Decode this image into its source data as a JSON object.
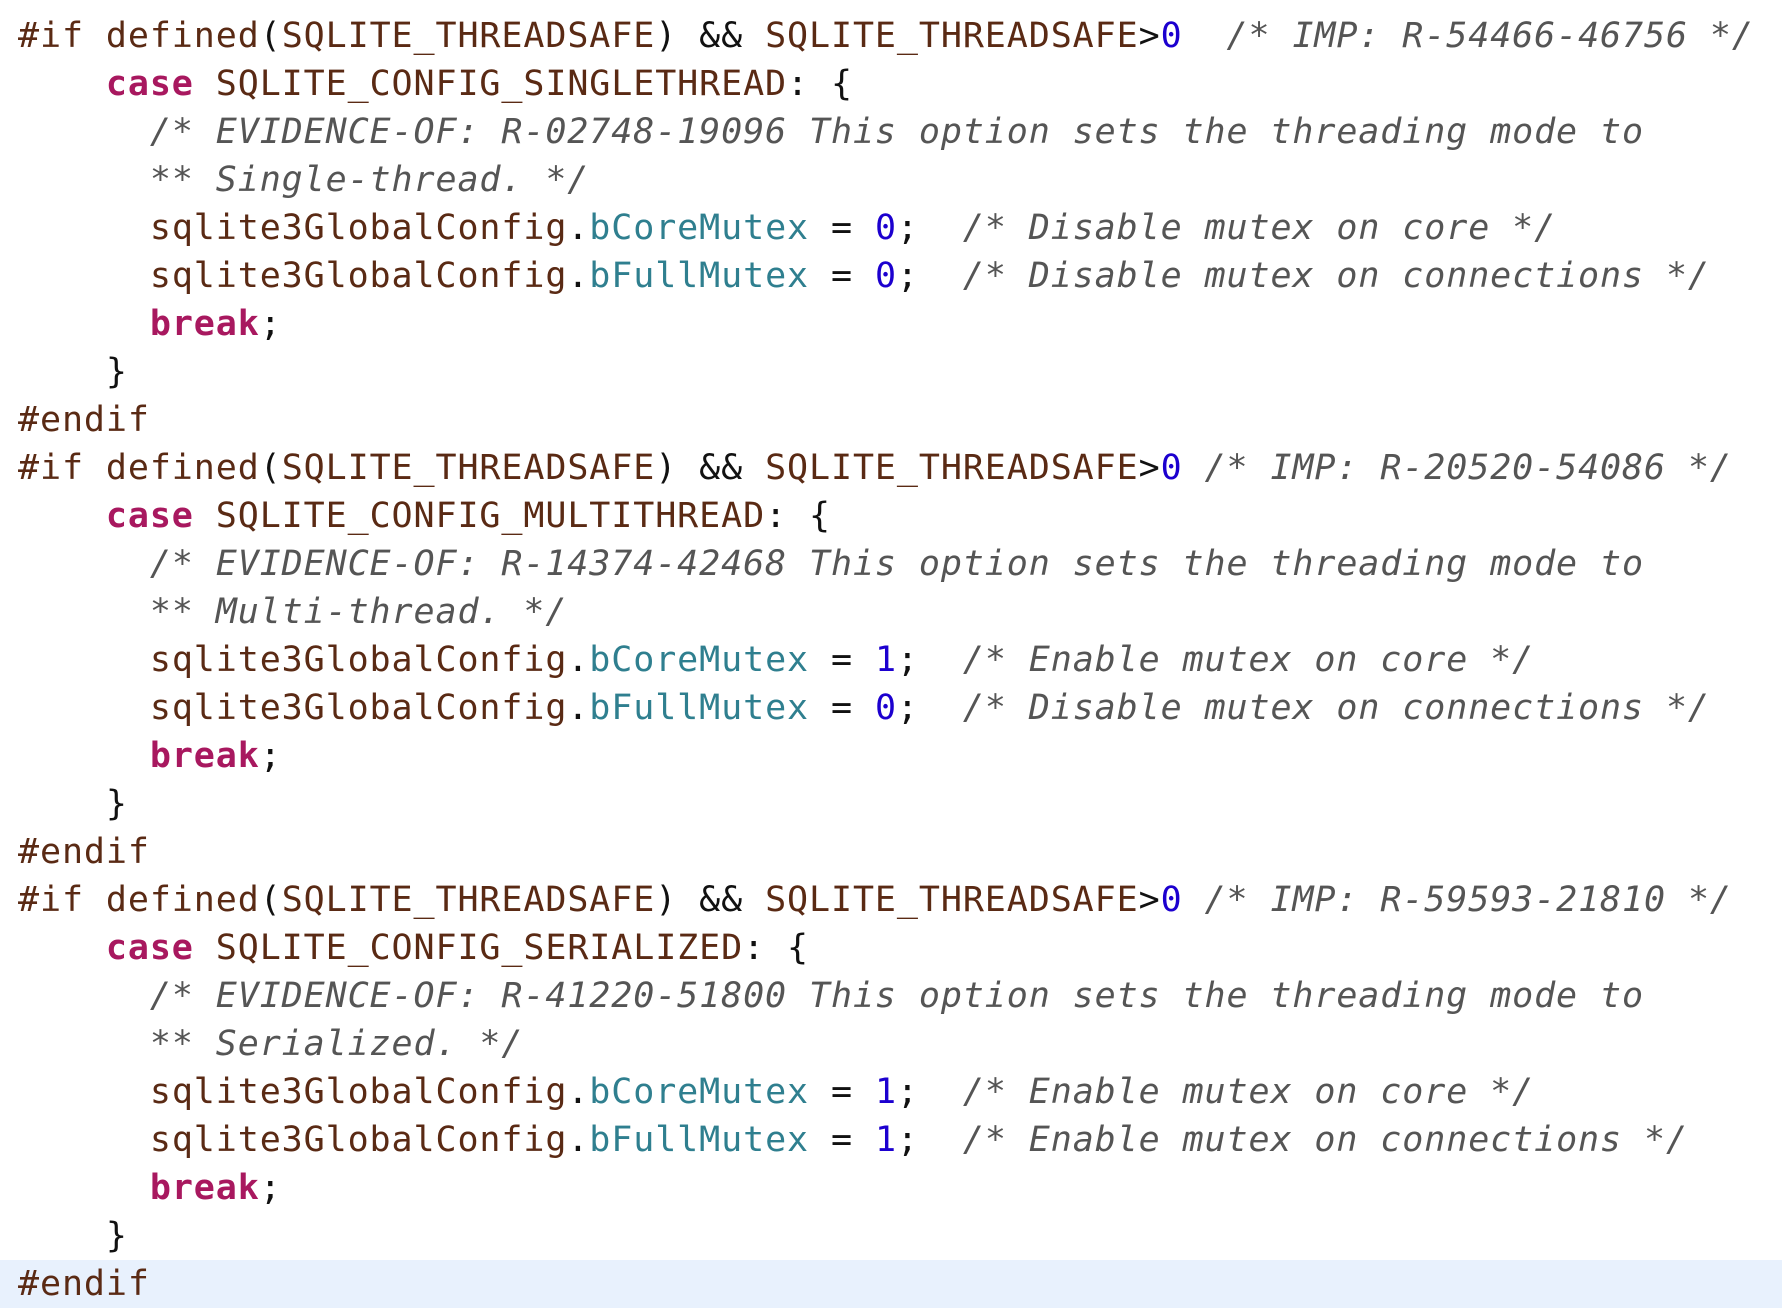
{
  "editor": {
    "colors": {
      "preprocessor": "#5a2a14",
      "keyword": "#a8185f",
      "identifier": "#5a2a14",
      "member": "#2f7f8f",
      "number": "#1c00cf",
      "comment": "#555555",
      "plain": "#111111",
      "current_line_bg": "#e8f1fd"
    },
    "current_line_index": 26,
    "lines": [
      [
        [
          "preproc",
          "#if "
        ],
        [
          "macro",
          "defined"
        ],
        [
          "plain",
          "("
        ],
        [
          "macro",
          "SQLITE_THREADSAFE"
        ],
        [
          "plain",
          ") && "
        ],
        [
          "macro",
          "SQLITE_THREADSAFE"
        ],
        [
          "plain",
          ">"
        ],
        [
          "number",
          "0"
        ],
        [
          "plain",
          "  "
        ],
        [
          "comment",
          "/* IMP: R-54466-46756 */"
        ]
      ],
      [
        [
          "plain",
          "    "
        ],
        [
          "keyword",
          "case"
        ],
        [
          "plain",
          " "
        ],
        [
          "ident",
          "SQLITE_CONFIG_SINGLETHREAD"
        ],
        [
          "plain",
          ": {"
        ]
      ],
      [
        [
          "plain",
          "      "
        ],
        [
          "comment",
          "/* EVIDENCE-OF: R-02748-19096 This option sets the threading mode to"
        ]
      ],
      [
        [
          "plain",
          "      "
        ],
        [
          "comment",
          "** Single-thread. */"
        ]
      ],
      [
        [
          "plain",
          "      "
        ],
        [
          "ident",
          "sqlite3GlobalConfig"
        ],
        [
          "plain",
          "."
        ],
        [
          "member",
          "bCoreMutex"
        ],
        [
          "plain",
          " = "
        ],
        [
          "number",
          "0"
        ],
        [
          "plain",
          ";  "
        ],
        [
          "comment",
          "/* Disable mutex on core */"
        ]
      ],
      [
        [
          "plain",
          "      "
        ],
        [
          "ident",
          "sqlite3GlobalConfig"
        ],
        [
          "plain",
          "."
        ],
        [
          "member",
          "bFullMutex"
        ],
        [
          "plain",
          " = "
        ],
        [
          "number",
          "0"
        ],
        [
          "plain",
          ";  "
        ],
        [
          "comment",
          "/* Disable mutex on connections */"
        ]
      ],
      [
        [
          "plain",
          "      "
        ],
        [
          "keyword",
          "break"
        ],
        [
          "plain",
          ";"
        ]
      ],
      [
        [
          "plain",
          "    }"
        ]
      ],
      [
        [
          "preproc",
          "#endif"
        ]
      ],
      [
        [
          "preproc",
          "#if "
        ],
        [
          "macro",
          "defined"
        ],
        [
          "plain",
          "("
        ],
        [
          "macro",
          "SQLITE_THREADSAFE"
        ],
        [
          "plain",
          ") && "
        ],
        [
          "macro",
          "SQLITE_THREADSAFE"
        ],
        [
          "plain",
          ">"
        ],
        [
          "number",
          "0"
        ],
        [
          "plain",
          " "
        ],
        [
          "comment",
          "/* IMP: R-20520-54086 */"
        ]
      ],
      [
        [
          "plain",
          "    "
        ],
        [
          "keyword",
          "case"
        ],
        [
          "plain",
          " "
        ],
        [
          "ident",
          "SQLITE_CONFIG_MULTITHREAD"
        ],
        [
          "plain",
          ": {"
        ]
      ],
      [
        [
          "plain",
          "      "
        ],
        [
          "comment",
          "/* EVIDENCE-OF: R-14374-42468 This option sets the threading mode to"
        ]
      ],
      [
        [
          "plain",
          "      "
        ],
        [
          "comment",
          "** Multi-thread. */"
        ]
      ],
      [
        [
          "plain",
          "      "
        ],
        [
          "ident",
          "sqlite3GlobalConfig"
        ],
        [
          "plain",
          "."
        ],
        [
          "member",
          "bCoreMutex"
        ],
        [
          "plain",
          " = "
        ],
        [
          "number",
          "1"
        ],
        [
          "plain",
          ";  "
        ],
        [
          "comment",
          "/* Enable mutex on core */"
        ]
      ],
      [
        [
          "plain",
          "      "
        ],
        [
          "ident",
          "sqlite3GlobalConfig"
        ],
        [
          "plain",
          "."
        ],
        [
          "member",
          "bFullMutex"
        ],
        [
          "plain",
          " = "
        ],
        [
          "number",
          "0"
        ],
        [
          "plain",
          ";  "
        ],
        [
          "comment",
          "/* Disable mutex on connections */"
        ]
      ],
      [
        [
          "plain",
          "      "
        ],
        [
          "keyword",
          "break"
        ],
        [
          "plain",
          ";"
        ]
      ],
      [
        [
          "plain",
          "    }"
        ]
      ],
      [
        [
          "preproc",
          "#endif"
        ]
      ],
      [
        [
          "preproc",
          "#if "
        ],
        [
          "macro",
          "defined"
        ],
        [
          "plain",
          "("
        ],
        [
          "macro",
          "SQLITE_THREADSAFE"
        ],
        [
          "plain",
          ") && "
        ],
        [
          "macro",
          "SQLITE_THREADSAFE"
        ],
        [
          "plain",
          ">"
        ],
        [
          "number",
          "0"
        ],
        [
          "plain",
          " "
        ],
        [
          "comment",
          "/* IMP: R-59593-21810 */"
        ]
      ],
      [
        [
          "plain",
          "    "
        ],
        [
          "keyword",
          "case"
        ],
        [
          "plain",
          " "
        ],
        [
          "ident",
          "SQLITE_CONFIG_SERIALIZED"
        ],
        [
          "plain",
          ": {"
        ]
      ],
      [
        [
          "plain",
          "      "
        ],
        [
          "comment",
          "/* EVIDENCE-OF: R-41220-51800 This option sets the threading mode to"
        ]
      ],
      [
        [
          "plain",
          "      "
        ],
        [
          "comment",
          "** Serialized. */"
        ]
      ],
      [
        [
          "plain",
          "      "
        ],
        [
          "ident",
          "sqlite3GlobalConfig"
        ],
        [
          "plain",
          "."
        ],
        [
          "member",
          "bCoreMutex"
        ],
        [
          "plain",
          " = "
        ],
        [
          "number",
          "1"
        ],
        [
          "plain",
          ";  "
        ],
        [
          "comment",
          "/* Enable mutex on core */"
        ]
      ],
      [
        [
          "plain",
          "      "
        ],
        [
          "ident",
          "sqlite3GlobalConfig"
        ],
        [
          "plain",
          "."
        ],
        [
          "member",
          "bFullMutex"
        ],
        [
          "plain",
          " = "
        ],
        [
          "number",
          "1"
        ],
        [
          "plain",
          ";  "
        ],
        [
          "comment",
          "/* Enable mutex on connections */"
        ]
      ],
      [
        [
          "plain",
          "      "
        ],
        [
          "keyword",
          "break"
        ],
        [
          "plain",
          ";"
        ]
      ],
      [
        [
          "plain",
          "    }"
        ]
      ],
      [
        [
          "preproc",
          "#endif"
        ]
      ]
    ]
  }
}
